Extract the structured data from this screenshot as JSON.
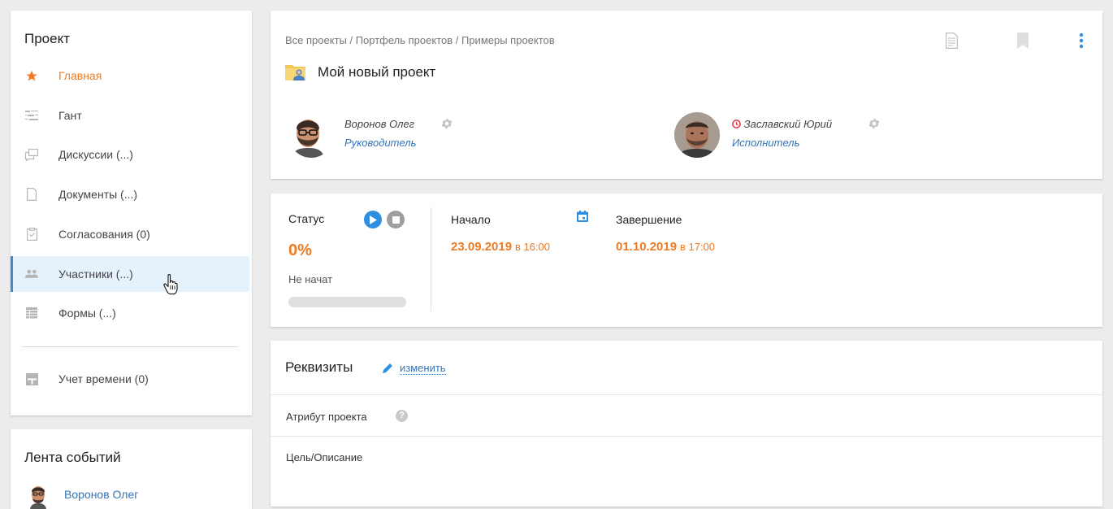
{
  "sidebar": {
    "title": "Проект",
    "items": [
      {
        "label": "Главная",
        "icon": "star-icon"
      },
      {
        "label": "Гант",
        "icon": "gantt-icon"
      },
      {
        "label": "Дискуссии (...)",
        "icon": "discussion-icon"
      },
      {
        "label": "Документы (...)",
        "icon": "document-icon"
      },
      {
        "label": "Согласования (0)",
        "icon": "approval-icon"
      },
      {
        "label": "Участники (...)",
        "icon": "participants-icon"
      },
      {
        "label": "Формы (...)",
        "icon": "forms-icon"
      },
      {
        "label": "Учет времени (0)",
        "icon": "time-tracking-icon"
      }
    ]
  },
  "feed": {
    "title": "Лента событий",
    "user": "Воронов Олег"
  },
  "header": {
    "breadcrumb": "Все проекты / Портфель проектов / Примеры проектов",
    "title": "Мой новый проект",
    "people": [
      {
        "name": "Воронов Олег",
        "role": "Руководитель"
      },
      {
        "name": "Заславский Юрий",
        "role": "Исполнитель"
      }
    ]
  },
  "status": {
    "label": "Статус",
    "percent": "0%",
    "progress": 0,
    "state": "Не начат",
    "start_label": "Начало",
    "start_date": "23.09.2019",
    "start_time": "в 16:00",
    "end_label": "Завершение",
    "end_date": "01.10.2019",
    "end_time": "в 17:00"
  },
  "requisites": {
    "title": "Реквизиты",
    "edit_label": "изменить",
    "attribute_label": "Атрибут проекта",
    "goal_label": "Цель/Описание"
  },
  "colors": {
    "accent": "#ee7a22",
    "link": "#3574b7",
    "selected_bg": "#e5f1fb",
    "play": "#2d8fe0"
  }
}
